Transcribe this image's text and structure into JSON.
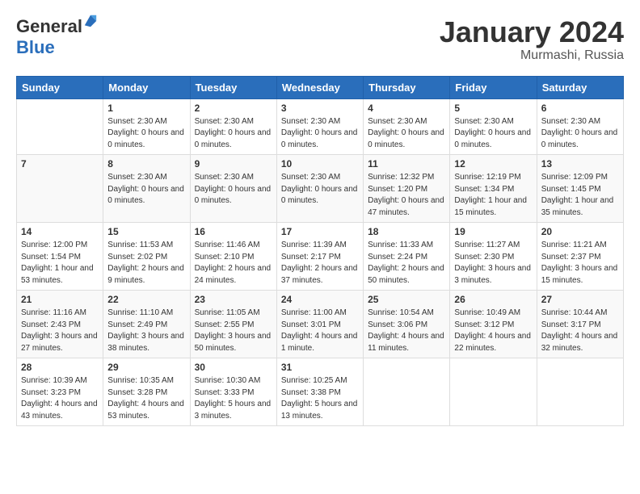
{
  "header": {
    "logo_general": "General",
    "logo_blue": "Blue",
    "month_title": "January 2024",
    "location": "Murmashi, Russia"
  },
  "weekdays": [
    "Sunday",
    "Monday",
    "Tuesday",
    "Wednesday",
    "Thursday",
    "Friday",
    "Saturday"
  ],
  "rows": [
    [
      {
        "day": "",
        "info": ""
      },
      {
        "day": "1",
        "info": "Sunset: 2:30 AM\nDaylight: 0 hours and 0 minutes."
      },
      {
        "day": "2",
        "info": "Sunset: 2:30 AM\nDaylight: 0 hours and 0 minutes."
      },
      {
        "day": "3",
        "info": "Sunset: 2:30 AM\nDaylight: 0 hours and 0 minutes."
      },
      {
        "day": "4",
        "info": "Sunset: 2:30 AM\nDaylight: 0 hours and 0 minutes."
      },
      {
        "day": "5",
        "info": "Sunset: 2:30 AM\nDaylight: 0 hours and 0 minutes."
      },
      {
        "day": "6",
        "info": "Sunset: 2:30 AM\nDaylight: 0 hours and 0 minutes."
      }
    ],
    [
      {
        "day": "7",
        "info": ""
      },
      {
        "day": "8",
        "info": "Sunset: 2:30 AM\nDaylight: 0 hours and 0 minutes."
      },
      {
        "day": "9",
        "info": "Sunset: 2:30 AM\nDaylight: 0 hours and 0 minutes."
      },
      {
        "day": "10",
        "info": "Sunset: 2:30 AM\nDaylight: 0 hours and 0 minutes."
      },
      {
        "day": "11",
        "info": "Sunrise: 12:32 PM\nSunset: 1:20 PM\nDaylight: 0 hours and 47 minutes."
      },
      {
        "day": "12",
        "info": "Sunrise: 12:19 PM\nSunset: 1:34 PM\nDaylight: 1 hour and 15 minutes."
      },
      {
        "day": "13",
        "info": "Sunrise: 12:09 PM\nSunset: 1:45 PM\nDaylight: 1 hour and 35 minutes."
      }
    ],
    [
      {
        "day": "14",
        "info": "Sunrise: 12:00 PM\nSunset: 1:54 PM\nDaylight: 1 hour and 53 minutes."
      },
      {
        "day": "15",
        "info": "Sunrise: 11:53 AM\nSunset: 2:02 PM\nDaylight: 2 hours and 9 minutes."
      },
      {
        "day": "16",
        "info": "Sunrise: 11:46 AM\nSunset: 2:10 PM\nDaylight: 2 hours and 24 minutes."
      },
      {
        "day": "17",
        "info": "Sunrise: 11:39 AM\nSunset: 2:17 PM\nDaylight: 2 hours and 37 minutes."
      },
      {
        "day": "18",
        "info": "Sunrise: 11:33 AM\nSunset: 2:24 PM\nDaylight: 2 hours and 50 minutes."
      },
      {
        "day": "19",
        "info": "Sunrise: 11:27 AM\nSunset: 2:30 PM\nDaylight: 3 hours and 3 minutes."
      },
      {
        "day": "20",
        "info": "Sunrise: 11:21 AM\nSunset: 2:37 PM\nDaylight: 3 hours and 15 minutes."
      }
    ],
    [
      {
        "day": "21",
        "info": "Sunrise: 11:16 AM\nSunset: 2:43 PM\nDaylight: 3 hours and 27 minutes."
      },
      {
        "day": "22",
        "info": "Sunrise: 11:10 AM\nSunset: 2:49 PM\nDaylight: 3 hours and 38 minutes."
      },
      {
        "day": "23",
        "info": "Sunrise: 11:05 AM\nSunset: 2:55 PM\nDaylight: 3 hours and 50 minutes."
      },
      {
        "day": "24",
        "info": "Sunrise: 11:00 AM\nSunset: 3:01 PM\nDaylight: 4 hours and 1 minute."
      },
      {
        "day": "25",
        "info": "Sunrise: 10:54 AM\nSunset: 3:06 PM\nDaylight: 4 hours and 11 minutes."
      },
      {
        "day": "26",
        "info": "Sunrise: 10:49 AM\nSunset: 3:12 PM\nDaylight: 4 hours and 22 minutes."
      },
      {
        "day": "27",
        "info": "Sunrise: 10:44 AM\nSunset: 3:17 PM\nDaylight: 4 hours and 32 minutes."
      }
    ],
    [
      {
        "day": "28",
        "info": "Sunrise: 10:39 AM\nSunset: 3:23 PM\nDaylight: 4 hours and 43 minutes."
      },
      {
        "day": "29",
        "info": "Sunrise: 10:35 AM\nSunset: 3:28 PM\nDaylight: 4 hours and 53 minutes."
      },
      {
        "day": "30",
        "info": "Sunrise: 10:30 AM\nSunset: 3:33 PM\nDaylight: 5 hours and 3 minutes."
      },
      {
        "day": "31",
        "info": "Sunrise: 10:25 AM\nSunset: 3:38 PM\nDaylight: 5 hours and 13 minutes."
      },
      {
        "day": "",
        "info": ""
      },
      {
        "day": "",
        "info": ""
      },
      {
        "day": "",
        "info": ""
      }
    ]
  ]
}
